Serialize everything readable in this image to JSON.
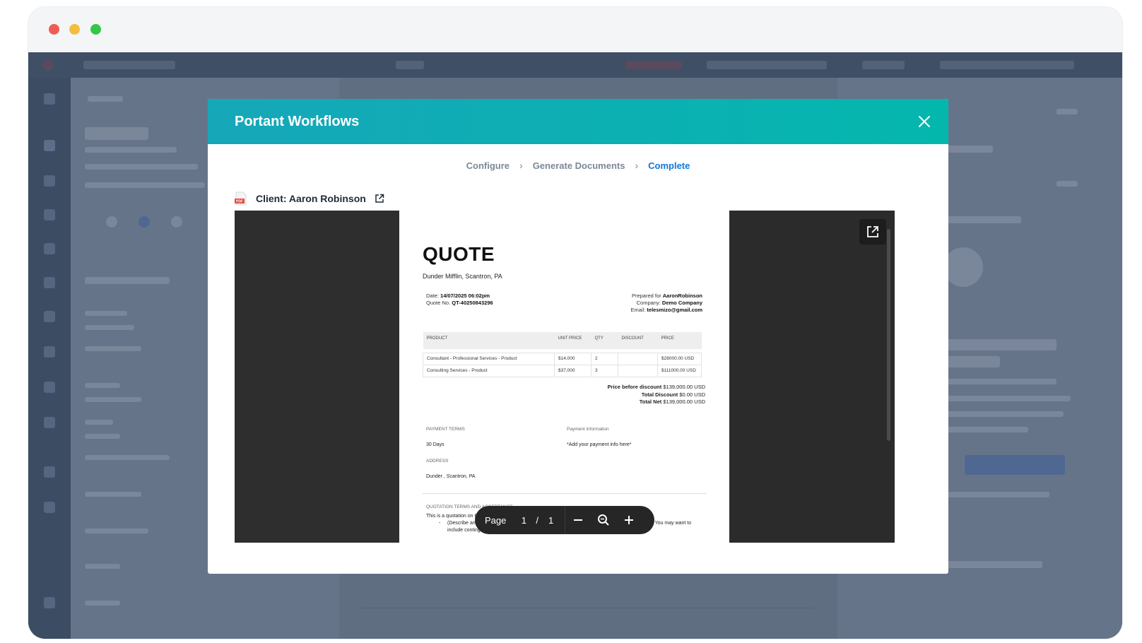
{
  "window_controls": {
    "close_color": "#ee5c55",
    "minimize_color": "#f4bd3e",
    "maximize_color": "#35c748"
  },
  "modal": {
    "title": "Portant Workflows",
    "header_colors": [
      "#16a7b9",
      "#04b7ad"
    ],
    "close_icon": "close-icon"
  },
  "steps": [
    {
      "label": "Configure",
      "state": "done"
    },
    {
      "label": "Generate Documents",
      "state": "done"
    },
    {
      "label": "Complete",
      "state": "active"
    }
  ],
  "document": {
    "client_label": "Client: Aaron Robinson",
    "file_icon": "pdf-icon",
    "open_icon": "external-link-icon"
  },
  "quote": {
    "title": "QUOTE",
    "company": "Dunder Mifflin, Scantron, PA",
    "date_label": "Date:",
    "date_value": "14/07/2025 06:02pm",
    "quote_no_label": "Quote No.",
    "quote_no_value": "QT-40250843296",
    "prepared_for_label": "Prepared for",
    "prepared_for_value": "AaronRobinson",
    "company_label": "Company:",
    "company_value": "Demo Company",
    "email_label": "Email:",
    "email_value": "telesmizo@gmail.com",
    "table_headers": [
      "PRODUCT",
      "UNIT PRICE",
      "QTY",
      "DISCOUNT",
      "PRICE"
    ],
    "table_rows": [
      [
        "Consultant - Professional Services - Product",
        "$14,000",
        "2",
        "",
        "$28000.00 USD"
      ],
      [
        "Consulting Services - Product",
        "$37,000",
        "3",
        "",
        "$111000.00 USD"
      ]
    ],
    "price_before_discount_label": "Price before discount",
    "price_before_discount_value": "$139,000.00 USD",
    "total_discount_label": "Total Discount",
    "total_discount_value": "$0.00 USD",
    "total_net_label": "Total Net",
    "total_net_value": "$139,000.00 USD",
    "payment_terms_label": "PAYMENT TERMS",
    "payment_terms_value": "30 Days",
    "payment_info_label": "Payment information",
    "payment_info_value": "*Add your payment info here*",
    "address_label": "ADDRESS",
    "address_value": "Dunder , Scantron, PA",
    "terms_label": "QUOTATION TERMS AND ACCEPTANCE",
    "terms_line1": "This is a quotation on the goods named, subject to the conditions noted below:",
    "terms_bullet": "(Describe any conditions pertaining to these prices and any additional terms of the agreement. You may want to include contingencies that will affect the quotation.)"
  },
  "pagebar": {
    "page_label": "Page",
    "current_page": "1",
    "separator": "/",
    "total_pages": "1",
    "zoom_out_icon": "minus-icon",
    "zoom_icon": "magnifier-icon",
    "zoom_in_icon": "plus-icon"
  }
}
